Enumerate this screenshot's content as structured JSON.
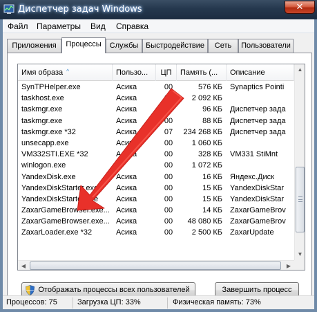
{
  "window": {
    "title": "Диспетчер задач Windows",
    "close_label": "✕"
  },
  "menu": {
    "items": [
      {
        "label": "Файл"
      },
      {
        "label": "Параметры"
      },
      {
        "label": "Вид"
      },
      {
        "label": "Справка"
      }
    ]
  },
  "tabs": [
    {
      "label": "Приложения",
      "active": false
    },
    {
      "label": "Процессы",
      "active": true
    },
    {
      "label": "Службы",
      "active": false
    },
    {
      "label": "Быстродействие",
      "active": false
    },
    {
      "label": "Сеть",
      "active": false
    },
    {
      "label": "Пользователи",
      "active": false
    }
  ],
  "table": {
    "sorted_column": "Имя образа",
    "columns": [
      {
        "label": "Имя образа"
      },
      {
        "label": "Пользо..."
      },
      {
        "label": "ЦП"
      },
      {
        "label": "Память (..."
      },
      {
        "label": "Описание"
      }
    ],
    "rows": [
      {
        "name": "SynTPHelper.exe",
        "user": "Асика",
        "cpu": "00",
        "mem": "576 КБ",
        "desc": "Synaptics Pointi"
      },
      {
        "name": "taskhost.exe",
        "user": "Асика",
        "cpu": "00",
        "mem": "2 092 КБ",
        "desc": ""
      },
      {
        "name": "taskmgr.exe",
        "user": "Асика",
        "cpu": "00",
        "mem": "96 КБ",
        "desc": "Диспетчер зада"
      },
      {
        "name": "taskmgr.exe",
        "user": "Асика",
        "cpu": "00",
        "mem": "88 КБ",
        "desc": "Диспетчер зада"
      },
      {
        "name": "taskmgr.exe *32",
        "user": "Асика",
        "cpu": "07",
        "mem": "234 268 КБ",
        "desc": "Диспетчер зада"
      },
      {
        "name": "unsecapp.exe",
        "user": "Асика",
        "cpu": "00",
        "mem": "1 060 КБ",
        "desc": ""
      },
      {
        "name": "VM332STI.EXE *32",
        "user": "Асика",
        "cpu": "00",
        "mem": "328 КБ",
        "desc": "VM331 StiMnt"
      },
      {
        "name": "winlogon.exe",
        "user": "",
        "cpu": "00",
        "mem": "1 072 КБ",
        "desc": ""
      },
      {
        "name": "YandexDisk.exe",
        "user": "Асика",
        "cpu": "00",
        "mem": "16 КБ",
        "desc": "Яндекс.Диск"
      },
      {
        "name": "YandexDiskStarter.exe",
        "user": "Асика",
        "cpu": "00",
        "mem": "15 КБ",
        "desc": "YandexDiskStar"
      },
      {
        "name": "YandexDiskStarter.exe",
        "user": "Асика",
        "cpu": "00",
        "mem": "15 КБ",
        "desc": "YandexDiskStar"
      },
      {
        "name": "ZaxarGameBrowser.exe...",
        "user": "Асика",
        "cpu": "00",
        "mem": "14 КБ",
        "desc": "ZaxarGameBrov"
      },
      {
        "name": "ZaxarGameBrowser.exe...",
        "user": "Асика",
        "cpu": "00",
        "mem": "48 080 КБ",
        "desc": "ZaxarGameBrov"
      },
      {
        "name": "ZaxarLoader.exe *32",
        "user": "Асика",
        "cpu": "00",
        "mem": "2 500 КБ",
        "desc": "ZaxarUpdate"
      }
    ]
  },
  "buttons": {
    "show_all": "Отображать процессы всех пользователей",
    "end_process": "Завершить процесс"
  },
  "status": {
    "processes": "Процессов: 75",
    "cpu": "Загрузка ЦП: 33%",
    "memory": "Физическая память: 73%"
  },
  "colors": {
    "annotation_arrow": "#e8312a",
    "titlebar": "#25384e",
    "close_button": "#c4462a"
  },
  "icons": {
    "window": "task-manager-icon",
    "uac": "uac-shield-icon"
  }
}
